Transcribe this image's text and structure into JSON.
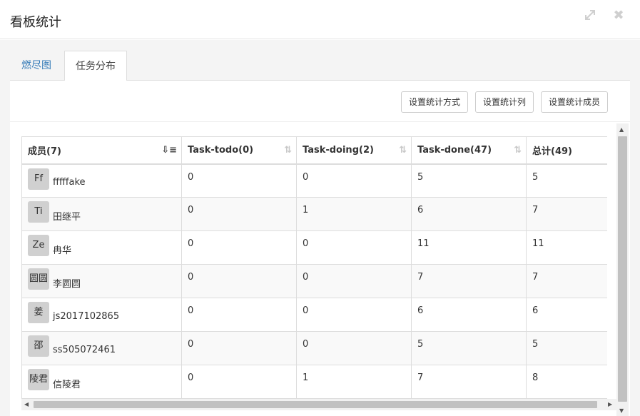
{
  "dialog": {
    "title": "看板统计",
    "icons": [
      "expand-icon",
      "close-icon"
    ]
  },
  "tabs": [
    {
      "label": "燃尽图",
      "active": false
    },
    {
      "label": "任务分布",
      "active": true
    }
  ],
  "toolbar": {
    "set_method": "设置统计方式",
    "set_columns": "设置统计列",
    "set_members": "设置统计成员"
  },
  "table": {
    "columns": [
      "成员(7)",
      "Task-todo(0)",
      "Task-doing(2)",
      "Task-done(47)",
      "总计(49)"
    ],
    "rows": [
      {
        "avatar": "Ff",
        "name": "fffffake",
        "todo": "0",
        "doing": "0",
        "done": "5",
        "total": "5"
      },
      {
        "avatar": "Ti",
        "name": "田继平",
        "todo": "0",
        "doing": "1",
        "done": "6",
        "total": "7"
      },
      {
        "avatar": "Ze",
        "name": "冉华",
        "todo": "0",
        "doing": "0",
        "done": "11",
        "total": "11"
      },
      {
        "avatar": "圆圆",
        "name": "李圆圆",
        "todo": "0",
        "doing": "0",
        "done": "7",
        "total": "7"
      },
      {
        "avatar": "姜",
        "name": "js2017102865",
        "todo": "0",
        "doing": "0",
        "done": "6",
        "total": "6"
      },
      {
        "avatar": "邵",
        "name": "ss505072461",
        "todo": "0",
        "doing": "0",
        "done": "5",
        "total": "5"
      },
      {
        "avatar": "陵君",
        "name": "信陵君",
        "todo": "0",
        "doing": "1",
        "done": "7",
        "total": "8"
      }
    ]
  },
  "colors": {
    "link": "#337ab7",
    "avatar_bg": "#d0d0d0",
    "border": "#dddddd"
  }
}
